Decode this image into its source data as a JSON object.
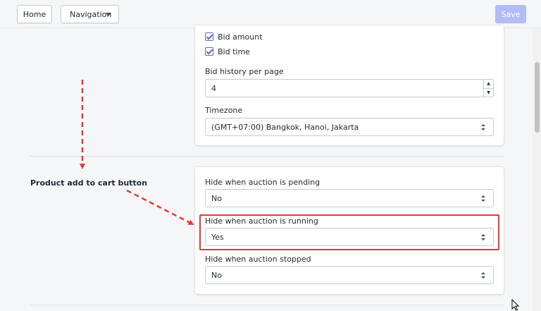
{
  "toolbar": {
    "home_label": "Home",
    "navigation_label": "Navigation",
    "save_label": "Save"
  },
  "bid_fields": {
    "bid_amount_label": "Bid amount",
    "bid_amount_checked": true,
    "bid_time_label": "Bid time",
    "bid_time_checked": true
  },
  "bid_history": {
    "label": "Bid history per page",
    "value": "4"
  },
  "timezone": {
    "label": "Timezone",
    "value": "(GMT+07:00) Bangkok, Hanoi, Jakarta"
  },
  "add_to_cart_section": {
    "title": "Product add to cart button",
    "pending": {
      "label": "Hide when auction is pending",
      "value": "No"
    },
    "running": {
      "label": "Hide when auction is running",
      "value": "Yes"
    },
    "stopped": {
      "label": "Hide when auction stopped",
      "value": "No"
    }
  },
  "annotation": {
    "arrow_color": "#e53935",
    "highlight_color": "#e53935"
  }
}
